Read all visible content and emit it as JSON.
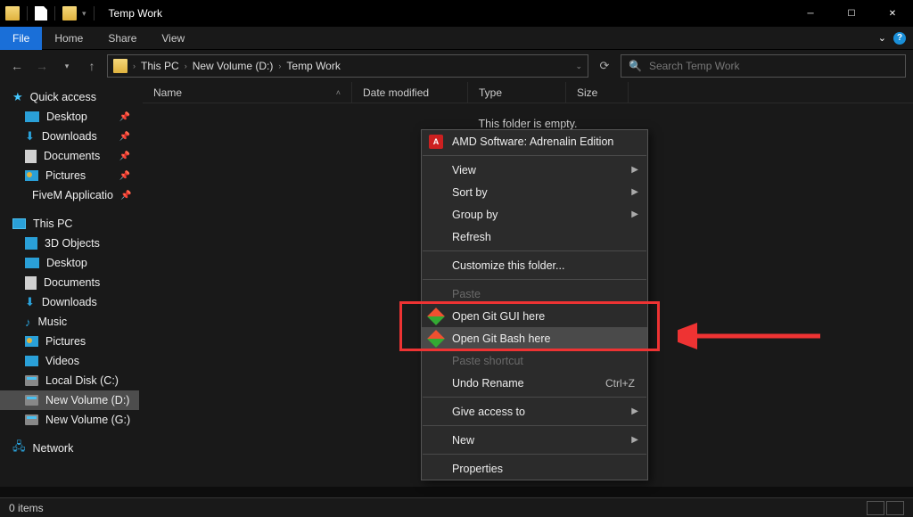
{
  "window": {
    "title": "Temp Work"
  },
  "ribbon": {
    "file": "File",
    "tabs": [
      "Home",
      "Share",
      "View"
    ]
  },
  "breadcrumb": {
    "parts": [
      "This PC",
      "New Volume (D:)",
      "Temp Work"
    ]
  },
  "search": {
    "placeholder": "Search Temp Work"
  },
  "columns": [
    "Name",
    "Date modified",
    "Type",
    "Size"
  ],
  "emptyText": "This folder is empty.",
  "sidebar": {
    "quickaccess": "Quick access",
    "qa": [
      {
        "label": "Desktop",
        "pin": true
      },
      {
        "label": "Downloads",
        "pin": true
      },
      {
        "label": "Documents",
        "pin": true
      },
      {
        "label": "Pictures",
        "pin": true
      },
      {
        "label": "FiveM Applicatio",
        "pin": true
      }
    ],
    "thispc": "This PC",
    "pc": [
      {
        "label": "3D Objects"
      },
      {
        "label": "Desktop"
      },
      {
        "label": "Documents"
      },
      {
        "label": "Downloads"
      },
      {
        "label": "Music"
      },
      {
        "label": "Pictures"
      },
      {
        "label": "Videos"
      },
      {
        "label": "Local Disk (C:)"
      },
      {
        "label": "New Volume (D:)",
        "selected": true
      },
      {
        "label": "New Volume (G:)"
      }
    ],
    "network": "Network"
  },
  "context": {
    "items": [
      {
        "label": "AMD Software: Adrenalin Edition",
        "icon": "amd"
      },
      {
        "sep": true
      },
      {
        "label": "View",
        "arrow": true
      },
      {
        "label": "Sort by",
        "arrow": true
      },
      {
        "label": "Group by",
        "arrow": true
      },
      {
        "label": "Refresh"
      },
      {
        "sep": true
      },
      {
        "label": "Customize this folder..."
      },
      {
        "sep": true
      },
      {
        "label": "Paste",
        "disabled": true
      },
      {
        "label": "Open Git GUI here",
        "icon": "git"
      },
      {
        "label": "Open Git Bash here",
        "icon": "git",
        "hover": true
      },
      {
        "label": "Paste shortcut",
        "disabled": true
      },
      {
        "label": "Undo Rename",
        "shortcut": "Ctrl+Z"
      },
      {
        "sep": true
      },
      {
        "label": "Give access to",
        "arrow": true
      },
      {
        "sep": true
      },
      {
        "label": "New",
        "arrow": true
      },
      {
        "sep": true
      },
      {
        "label": "Properties"
      }
    ]
  },
  "status": {
    "text": "0 items"
  }
}
